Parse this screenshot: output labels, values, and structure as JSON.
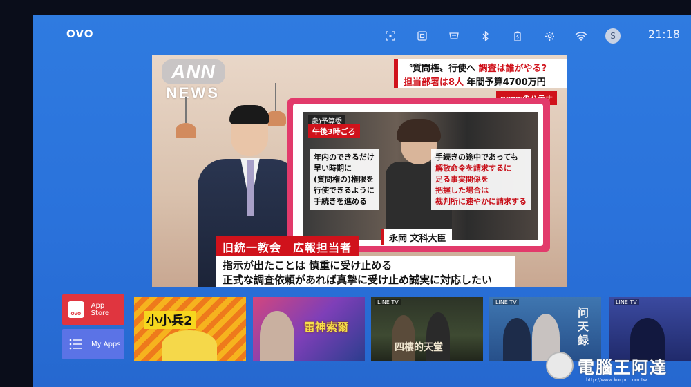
{
  "topbar": {
    "logo": "OVO",
    "avatar_letter": "S",
    "clock": "21:18",
    "icons": [
      "screen-capture-icon",
      "screen-mirror-icon",
      "input-source-icon",
      "bluetooth-icon",
      "battery-icon",
      "settings-icon",
      "wifi-icon"
    ]
  },
  "video": {
    "ann_logo": "ANN",
    "news_word": "NEWS",
    "headline_line1_prefix": "〝質問権〟行使へ",
    "headline_line1_red": "調査は誰がやる?",
    "headline_line2_red": "担当部署は8人",
    "headline_line2_rest": "年間予算4700万円",
    "tag": "newsのハテナ",
    "label_committee": "衆)予算委",
    "label_time": "午後3時ごろ",
    "quote_left": [
      "年内のできるだけ",
      "早い時期に",
      "(質問権の)権限を",
      "行使できるように",
      "手続きを進める"
    ],
    "quote_right_line1": "手続きの途中であっても",
    "quote_right_red": [
      "解散命令を請求するに",
      "足る事実関係を",
      "把握した場合は",
      "裁判所に速やかに請求する"
    ],
    "minister_name": "永岡 文科大臣",
    "lower_title": "旧統一教会　広報担当者",
    "lower_line1": "指示が出たことは 慎重に受け止める",
    "lower_line2": "正式な調査依頼があれば真摯に受け止め誠実に対応したい"
  },
  "apps": {
    "app_store": "App Store",
    "my_apps": "My Apps",
    "ovo_badge": "OVO"
  },
  "posters": [
    {
      "tag": "",
      "title": "小小兵2"
    },
    {
      "tag": "",
      "title": "雷神索爾"
    },
    {
      "tag": "LINE TV",
      "title": "四樓的天堂"
    },
    {
      "tag": "LINE TV",
      "title": "问天録"
    },
    {
      "tag": "LINE TV",
      "title": ""
    }
  ],
  "watermark": {
    "text": "電腦王阿達",
    "url": "http://www.kocpc.com.tw"
  },
  "colors": {
    "background_blue": "#2f7be0",
    "app_store_red": "#e0353f",
    "my_apps_blue": "#5b73e6",
    "news_red": "#d0121b"
  }
}
